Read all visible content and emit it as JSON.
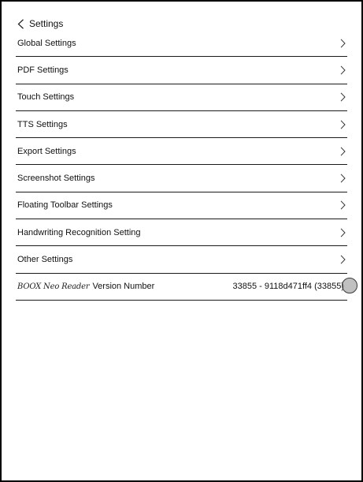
{
  "header": {
    "back_icon": "chevron-left-icon",
    "title": "Settings"
  },
  "settings_items": [
    {
      "label": "Global Settings",
      "icon": "chevron-right-icon"
    },
    {
      "label": "PDF Settings",
      "icon": "chevron-right-icon"
    },
    {
      "label": "Touch Settings",
      "icon": "chevron-right-icon"
    },
    {
      "label": "TTS Settings",
      "icon": "chevron-right-icon"
    },
    {
      "label": "Export Settings",
      "icon": "chevron-right-icon"
    },
    {
      "label": "Screenshot Settings",
      "icon": "chevron-right-icon"
    },
    {
      "label": "Floating Toolbar Settings",
      "icon": "chevron-right-icon"
    },
    {
      "label": "Handwriting Recognition Setting",
      "icon": "chevron-right-icon"
    },
    {
      "label": "Other Settings",
      "icon": "chevron-right-icon"
    }
  ],
  "version": {
    "brand": "BOOX Neo Reader",
    "label": "Version Number",
    "value": "33855 - 9118d471ff4 (33855)"
  },
  "colors": {
    "background": "#ffffff",
    "text": "#111111",
    "divider": "#1a1a1a",
    "touch_indicator": "#8c8c8c"
  }
}
